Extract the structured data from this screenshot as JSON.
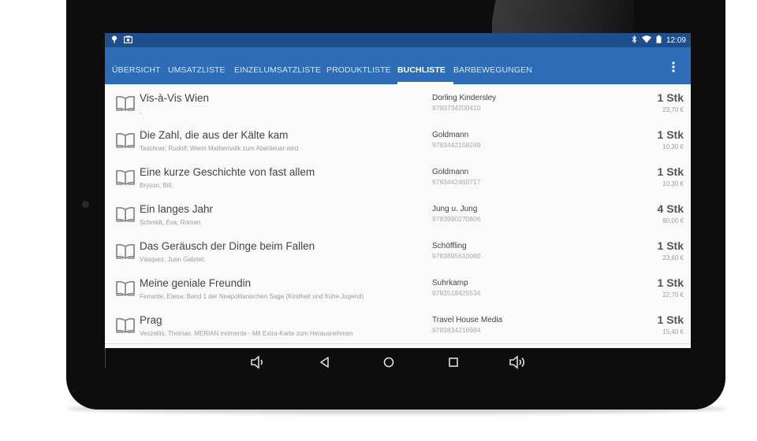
{
  "statusbar": {
    "time": "12:09"
  },
  "tabs": [
    {
      "label": "ÜBERSICHT"
    },
    {
      "label": "UMSATZLISTE"
    },
    {
      "label": "EINZELUMSATZLISTE"
    },
    {
      "label": "PRODUKTLISTE"
    },
    {
      "label": "BUCHLISTE"
    },
    {
      "label": "BARBEWEGUNGEN"
    }
  ],
  "active_tab": "BUCHLISTE",
  "menu_icon": "more-vertical-icon",
  "books": [
    {
      "title": "Vis-à-Vis Wien",
      "subtitle": ";",
      "publisher": "Dorling Kindersley",
      "isbn": "9783734200410",
      "qty": "1 Stk",
      "price": "23,70 €"
    },
    {
      "title": "Die Zahl, die aus der Kälte kam",
      "subtitle": "Taschner, Rudolf; Wenn Mathematik zum Abenteuer wird",
      "publisher": "Goldmann",
      "isbn": "9783442158249",
      "qty": "1 Stk",
      "price": "10,30 €"
    },
    {
      "title": "Eine kurze Geschichte von fast allem",
      "subtitle": "Bryson, Bill;",
      "publisher": "Goldmann",
      "isbn": "9783442460717",
      "qty": "1 Stk",
      "price": "10,30 €"
    },
    {
      "title": "Ein langes Jahr",
      "subtitle": "Schmidt, Eva; Roman",
      "publisher": "Jung u. Jung",
      "isbn": "9783990270806",
      "qty": "4 Stk",
      "price": "80,00 €"
    },
    {
      "title": "Das Geräusch der Dinge beim Fallen",
      "subtitle": "Vásquez, Juan Gabriel;",
      "publisher": "Schöffling",
      "isbn": "9783895610080",
      "qty": "1 Stk",
      "price": "23,60 €"
    },
    {
      "title": "Meine geniale Freundin",
      "subtitle": "Ferrante, Elena; Band 1 der Neapolitanischen Saga (Kindheit und frühe Jugend)",
      "publisher": "Suhrkamp",
      "isbn": "9783518425534",
      "qty": "1 Stk",
      "price": "22,70 €"
    },
    {
      "title": "Prag",
      "subtitle": "Veszelits, Thomas; MERIAN momente - Mit Extra-Karte zum Herausnehmen",
      "publisher": "Travel House Media",
      "isbn": "9783834216984",
      "qty": "1 Stk",
      "price": "15,40 €"
    }
  ],
  "icons": {
    "row": "book-icon",
    "nav": [
      "volume-down-icon",
      "back-icon",
      "home-icon",
      "recents-icon",
      "volume-up-icon"
    ]
  },
  "colors": {
    "statusbar": "#1e4e8c",
    "tabbar": "#2e6db5",
    "list_bg": "#fafafa",
    "bezel": "#0d0d0d"
  }
}
